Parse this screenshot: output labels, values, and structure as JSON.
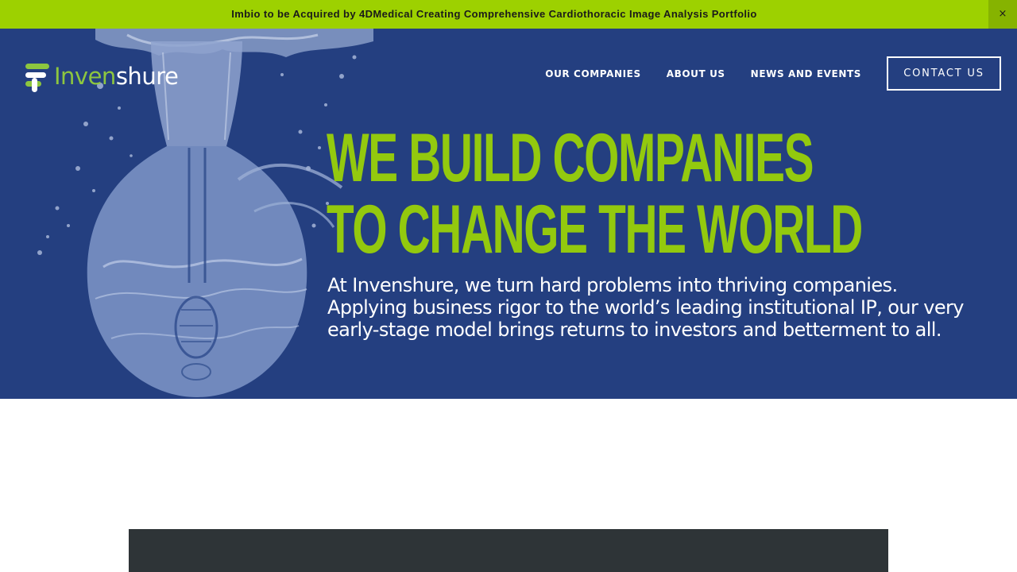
{
  "announcement": {
    "text": "Imbio to be Acquired by 4DMedical Creating Comprehensive Cardiothoracic Image Analysis Portfolio",
    "close_label": "×"
  },
  "brand": {
    "logo_part1": "Inven",
    "logo_part2": "shure",
    "accent_color": "#9dd100",
    "hero_bg_color": "#243f80",
    "headline_color": "#93c90e"
  },
  "nav": {
    "items": [
      {
        "label": "OUR COMPANIES"
      },
      {
        "label": "ABOUT US"
      },
      {
        "label": "NEWS AND EVENTS"
      }
    ],
    "cta_label": "CONTACT US"
  },
  "hero": {
    "headline_line1": "WE BUILD COMPANIES",
    "headline_line2": "TO CHANGE THE WORLD",
    "intro": "At Invenshure, we turn hard problems into thriving companies. Applying business rigor to the world’s leading institutional IP, our very early-stage model brings returns to investors and betterment to all.",
    "image_subject": "upside-down-light-bulb-splashing-in-water"
  }
}
